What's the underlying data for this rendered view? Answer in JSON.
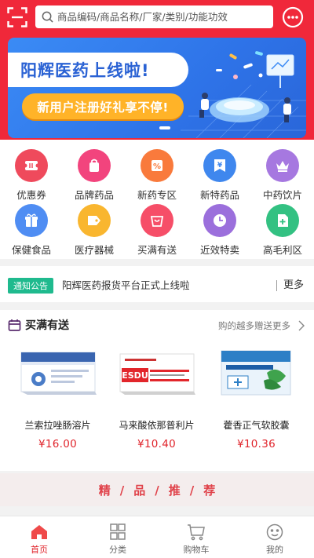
{
  "header": {
    "search_placeholder": "商品编码/商品名称/厂家/类别/功能功效",
    "scan_icon": "scan-icon",
    "message_icon": "message-icon"
  },
  "banner": {
    "title": "阳辉医药上线啦!",
    "subtitle": "新用户注册好礼享不停!"
  },
  "categories": [
    {
      "label": "优惠券",
      "color": "#ef4a5c",
      "icon": "coupon-icon"
    },
    {
      "label": "品牌药品",
      "color": "#f2447d",
      "icon": "bag-icon"
    },
    {
      "label": "新药专区",
      "color": "#f97a3c",
      "icon": "percent-icon"
    },
    {
      "label": "新特药品",
      "color": "#3f87ee",
      "icon": "yen-icon"
    },
    {
      "label": "中药饮片",
      "color": "#a678e0",
      "icon": "crown-icon"
    },
    {
      "label": "保健食品",
      "color": "#4f8df3",
      "icon": "gift-icon"
    },
    {
      "label": "医疗器械",
      "color": "#f9b62f",
      "icon": "tag-icon"
    },
    {
      "label": "买满有送",
      "color": "#f64e68",
      "icon": "cart-bag-icon"
    },
    {
      "label": "近效特卖",
      "color": "#9b6fdc",
      "icon": "clock-icon"
    },
    {
      "label": "高毛利区",
      "color": "#33c182",
      "icon": "add-doc-icon"
    }
  ],
  "notice": {
    "tag": "通知公告",
    "text": "阳辉医药报货平台正式上线啦",
    "more": "更多"
  },
  "promo": {
    "title": "买满有送",
    "more": "购的越多赠送更多",
    "products": [
      {
        "name": "兰索拉唑肠溶片",
        "price": "¥16.00"
      },
      {
        "name": "马来酸依那普利片",
        "price": "¥10.40"
      },
      {
        "name": "藿香正气软胶囊",
        "price": "¥10.36"
      }
    ]
  },
  "featured": {
    "title": "精/品/推/荐"
  },
  "tabbar": [
    {
      "label": "首页",
      "icon": "home-icon",
      "active": true
    },
    {
      "label": "分类",
      "icon": "category-icon",
      "active": false
    },
    {
      "label": "购物车",
      "icon": "cart-icon",
      "active": false
    },
    {
      "label": "我的",
      "icon": "profile-icon",
      "active": false
    }
  ],
  "colors": {
    "brand_red": "#f0283a",
    "price_red": "#e0242b",
    "notice_green": "#1fba8e"
  }
}
